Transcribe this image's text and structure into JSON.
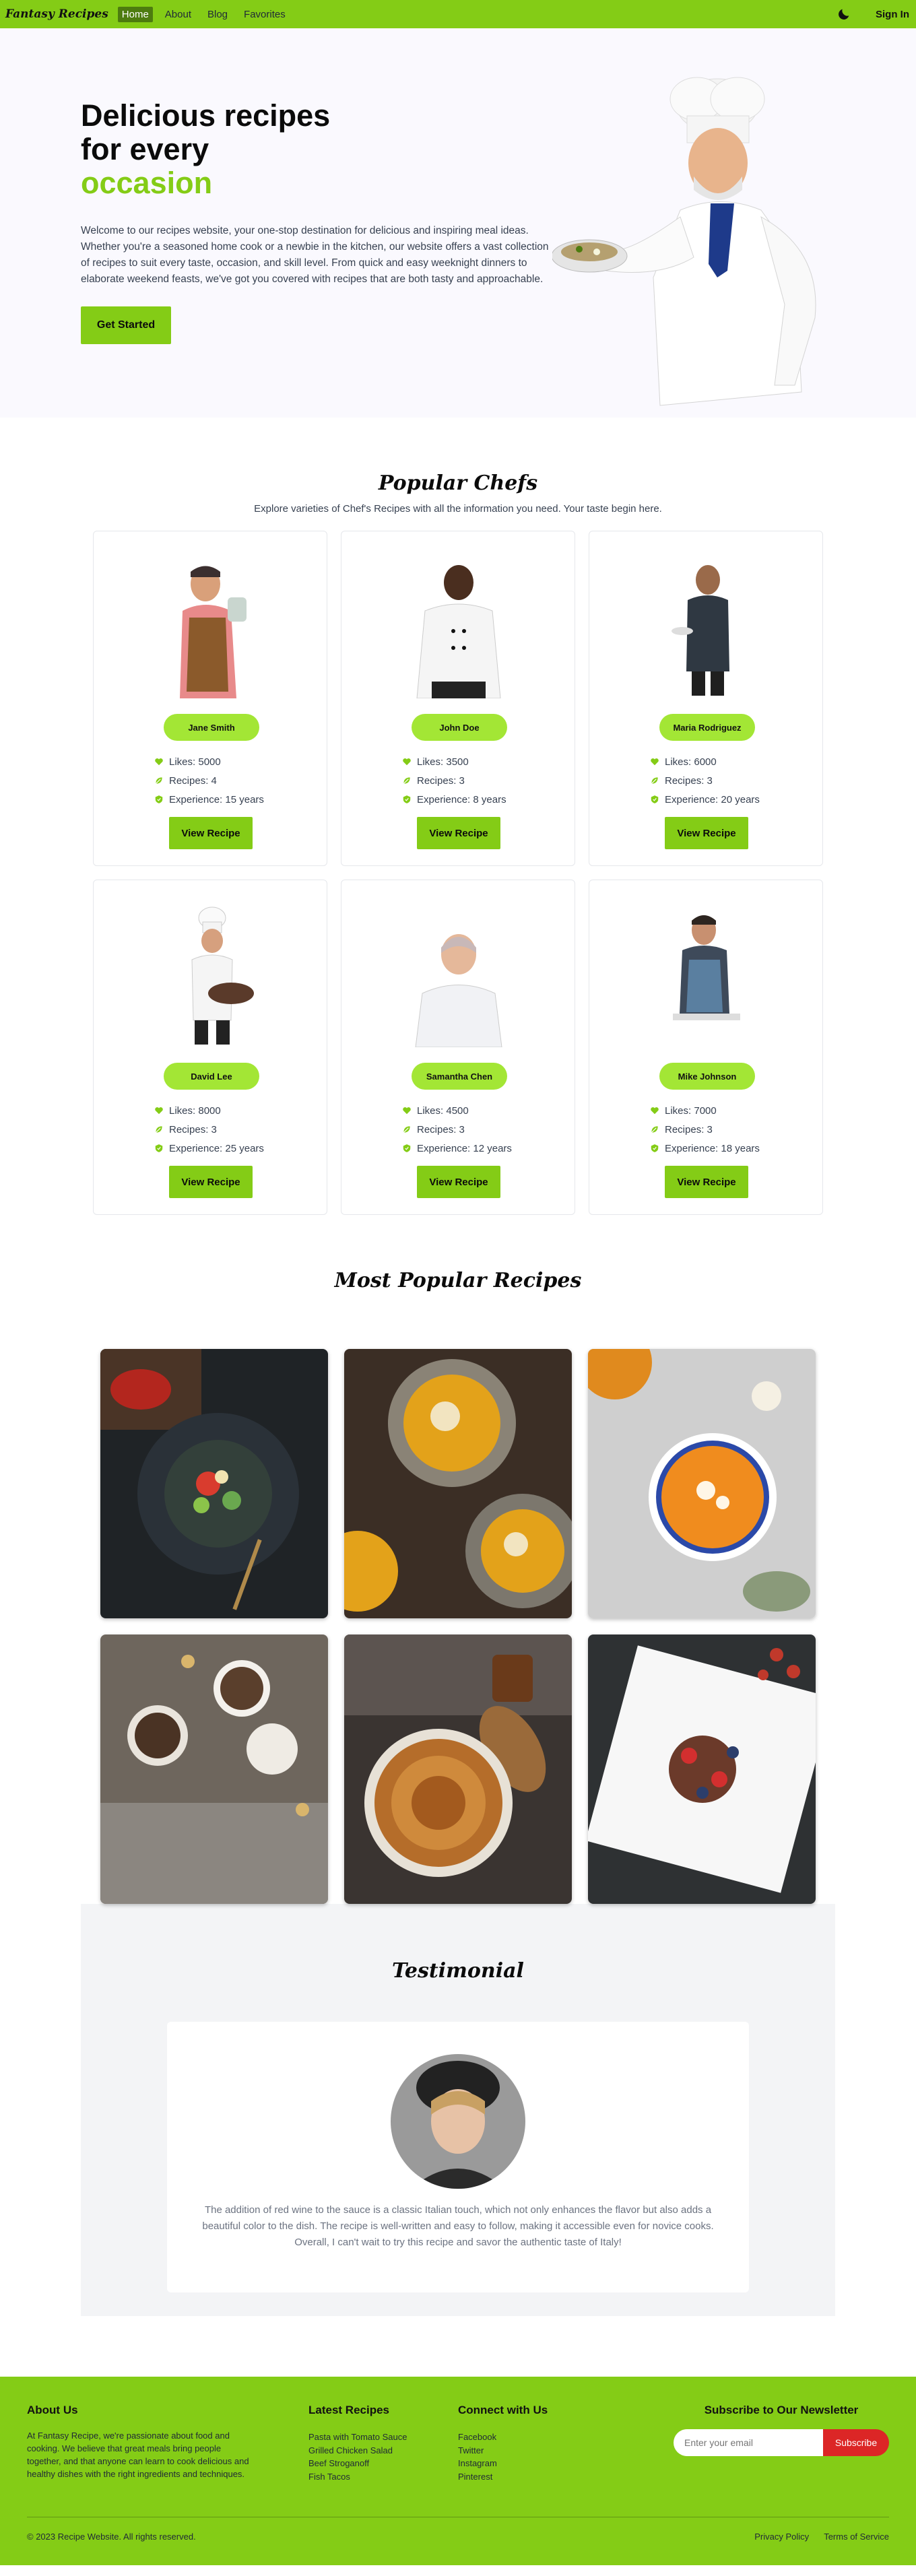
{
  "nav": {
    "brand": "Fantasy Recipes",
    "links": [
      "Home",
      "About",
      "Blog",
      "Favorites"
    ],
    "signin": "Sign In"
  },
  "hero": {
    "title_line1": "Delicious recipes",
    "title_line2": "for every",
    "title_accent": "occasion",
    "description": "Welcome to our recipes website, your one-stop destination for delicious and inspiring meal ideas. Whether you're a seasoned home cook or a newbie in the kitchen, our website offers a vast collection of recipes to suit every taste, occasion, and skill level. From quick and easy weeknight dinners to elaborate weekend feasts, we've got you covered with recipes that are both tasty and approachable.",
    "cta": "Get Started"
  },
  "chefs": {
    "title": "Popular Chefs",
    "subtitle": "Explore varieties of Chef's Recipes with all the information you need. Your taste begin here.",
    "button_label": "View Recipe",
    "items": [
      {
        "name": "Jane Smith",
        "likes": "Likes: 5000",
        "recipes": "Recipes: 4",
        "experience": "Experience: 15 years"
      },
      {
        "name": "John Doe",
        "likes": "Likes: 3500",
        "recipes": "Recipes: 3",
        "experience": "Experience: 8 years"
      },
      {
        "name": "Maria Rodriguez",
        "likes": "Likes: 6000",
        "recipes": "Recipes: 3",
        "experience": "Experience: 20 years"
      },
      {
        "name": "David Lee",
        "likes": "Likes: 8000",
        "recipes": "Recipes: 3",
        "experience": "Experience: 25 years"
      },
      {
        "name": "Samantha Chen",
        "likes": "Likes: 4500",
        "recipes": "Recipes: 3",
        "experience": "Experience: 12 years"
      },
      {
        "name": "Mike Johnson",
        "likes": "Likes: 7000",
        "recipes": "Recipes: 3",
        "experience": "Experience: 18 years"
      }
    ]
  },
  "recipes": {
    "title": "Most Popular Recipes"
  },
  "testimonial": {
    "title": "Testimonial",
    "text": "The addition of red wine to the sauce is a classic Italian touch, which not only enhances the flavor but also adds a beautiful color to the dish. The recipe is well-written and easy to follow, making it accessible even for novice cooks. Overall, I can't wait to try this recipe and savor the authentic taste of Italy!"
  },
  "footer": {
    "about_title": "About Us",
    "about_text": "At Fantasy Recipe, we're passionate about food and cooking. We believe that great meals bring people together, and that anyone can learn to cook delicious and healthy dishes with the right ingredients and techniques.",
    "latest_title": "Latest Recipes",
    "latest_items": [
      "Pasta with Tomato Sauce",
      "Grilled Chicken Salad",
      "Beef Stroganoff",
      "Fish Tacos"
    ],
    "connect_title": "Connect with Us",
    "connect_items": [
      "Facebook",
      "Twitter",
      "Instagram",
      "Pinterest"
    ],
    "newsletter_title": "Subscribe to Our Newsletter",
    "email_placeholder": "Enter your email",
    "subscribe_label": "Subscribe",
    "copyright": "© 2023 Recipe Website. All rights reserved.",
    "privacy": "Privacy Policy",
    "terms": "Terms of Service"
  },
  "colors": {
    "accent": "#84cc16",
    "accent_light": "#a3e635",
    "subscribe": "#dc2626",
    "hero_bg": "#faf9fe"
  },
  "icons": [
    "moon-icon",
    "heart-icon",
    "leaf-icon",
    "shield-check-icon"
  ]
}
